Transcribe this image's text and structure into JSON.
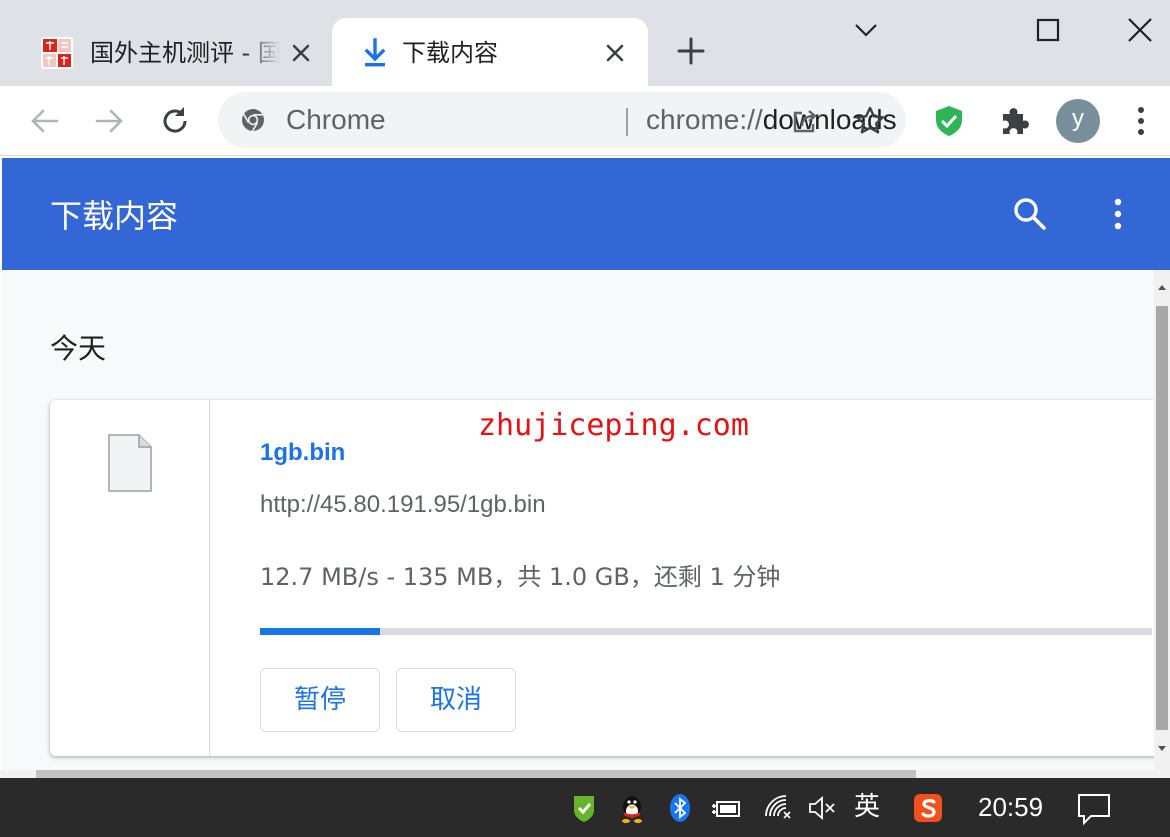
{
  "tabs": [
    {
      "title": "国外主机测评 - 国",
      "active": false
    },
    {
      "title": "下载内容",
      "active": true
    }
  ],
  "toolbar": {
    "chip": "Chrome",
    "url_scheme": "chrome://",
    "url_host": "downloads",
    "avatar_letter": "y"
  },
  "page": {
    "title": "下载内容",
    "section_date": "今天"
  },
  "download": {
    "file_name": "1gb.bin",
    "url": "http://45.80.191.95/1gb.bin",
    "status": "12.7 MB/s - 135 MB，共 1.0 GB，还剩 1 分钟",
    "progress_fraction": 0.135,
    "pause_label": "暂停",
    "cancel_label": "取消"
  },
  "watermark": "zhujiceping.com",
  "taskbar": {
    "ime_label": "英",
    "clock": "20:59"
  },
  "colors": {
    "header_blue": "#3367d6",
    "link_blue": "#1a73e8",
    "watermark_red": "#e81010",
    "tabstrip_gray": "#dee1e6",
    "taskbar_bg": "#2a2a2a"
  },
  "icons": [
    "site-favicon",
    "download-icon",
    "close-icon",
    "plus-icon",
    "chevron-down-icon",
    "maximize-icon",
    "back-arrow-icon",
    "forward-arrow-icon",
    "reload-icon",
    "chrome-logo-icon",
    "share-icon",
    "star-icon",
    "shield-check-icon",
    "puzzle-icon",
    "search-icon",
    "more-vert-icon",
    "file-icon",
    "qq-penguin-icon",
    "bluetooth-icon",
    "battery-icon",
    "wifi-icon",
    "speaker-mute-icon",
    "sogou-ime-icon",
    "notification-icon"
  ]
}
